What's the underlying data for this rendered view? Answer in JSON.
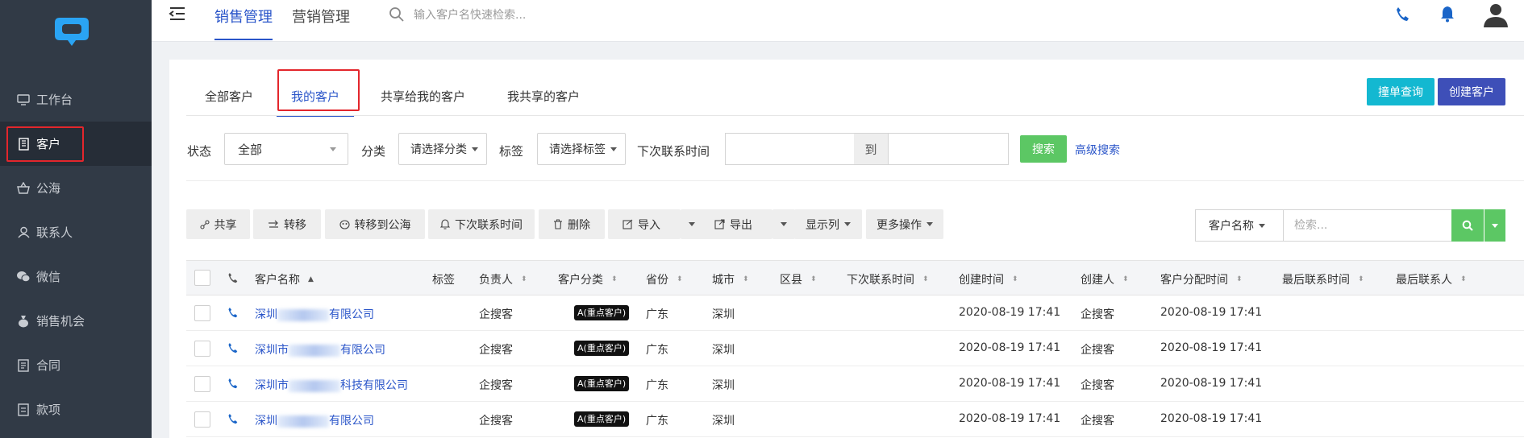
{
  "sidebar": {
    "items": [
      {
        "label": "工作台",
        "icon": "monitor-icon"
      },
      {
        "label": "客户",
        "icon": "building-icon",
        "active": true
      },
      {
        "label": "公海",
        "icon": "basket-icon"
      },
      {
        "label": "联系人",
        "icon": "user-icon"
      },
      {
        "label": "微信",
        "icon": "wechat-icon"
      },
      {
        "label": "销售机会",
        "icon": "moneybag-icon"
      },
      {
        "label": "合同",
        "icon": "contract-icon"
      },
      {
        "label": "款项",
        "icon": "payment-icon"
      }
    ]
  },
  "topbar": {
    "tabs": [
      {
        "label": "销售管理",
        "active": true
      },
      {
        "label": "营销管理",
        "active": false
      }
    ],
    "search_placeholder": "输入客户名快速检索..."
  },
  "subtabs": [
    {
      "label": "全部客户"
    },
    {
      "label": "我的客户",
      "active": true
    },
    {
      "label": "共享给我的客户"
    },
    {
      "label": "我共享的客户"
    }
  ],
  "actions": {
    "dedupe_query": "撞单查询",
    "create_customer": "创建客户"
  },
  "filters": {
    "status_label": "状态",
    "status_value": "全部",
    "category_label": "分类",
    "category_placeholder": "请选择分类",
    "tag_label": "标签",
    "tag_placeholder": "请选择标签",
    "next_contact_label": "下次联系时间",
    "date_separator": "到",
    "search_button": "搜索",
    "advanced_search": "高级搜索"
  },
  "toolbar": {
    "share": "共享",
    "transfer": "转移",
    "move_to_pool": "转移到公海",
    "next_contact": "下次联系时间",
    "delete": "删除",
    "import": "导入",
    "export": "导出",
    "columns": "显示列",
    "more": "更多操作",
    "search_field_select": "客户名称",
    "search_placeholder": "检索..."
  },
  "table": {
    "headers": {
      "name": "客户名称",
      "tags": "标签",
      "owner": "负责人",
      "category": "客户分类",
      "province": "省份",
      "city": "城市",
      "district": "区县",
      "next_contact": "下次联系时间",
      "created_time": "创建时间",
      "creator": "创建人",
      "assigned_time": "客户分配时间",
      "last_contact_time": "最后联系时间",
      "last_contact_person": "最后联系人"
    },
    "rows": [
      {
        "name_prefix": "深圳",
        "name_suffix": "有限公司",
        "owner": "企搜客",
        "category": "A(重点客户)",
        "province": "广东",
        "city": "深圳",
        "created_time": "2020-08-19 17:41",
        "creator": "企搜客",
        "assigned_time": "2020-08-19 17:41"
      },
      {
        "name_prefix": "深圳市",
        "name_suffix": "有限公司",
        "owner": "企搜客",
        "category": "A(重点客户)",
        "province": "广东",
        "city": "深圳",
        "created_time": "2020-08-19 17:41",
        "creator": "企搜客",
        "assigned_time": "2020-08-19 17:41"
      },
      {
        "name_prefix": "深圳市",
        "name_suffix": "科技有限公司",
        "owner": "企搜客",
        "category": "A(重点客户)",
        "province": "广东",
        "city": "深圳",
        "created_time": "2020-08-19 17:41",
        "creator": "企搜客",
        "assigned_time": "2020-08-19 17:41"
      },
      {
        "name_prefix": "深圳",
        "name_suffix": "有限公司",
        "owner": "企搜客",
        "category": "A(重点客户)",
        "province": "广东",
        "city": "深圳",
        "created_time": "2020-08-19 17:41",
        "creator": "企搜客",
        "assigned_time": "2020-08-19 17:41"
      }
    ]
  },
  "colors": {
    "sidebar_bg": "#313a46",
    "accent_blue": "#2a55c9",
    "highlight_red": "#e3262c",
    "teal_button": "#13b8d1",
    "indigo_button": "#3e4fb8",
    "green_button": "#5cc764"
  }
}
